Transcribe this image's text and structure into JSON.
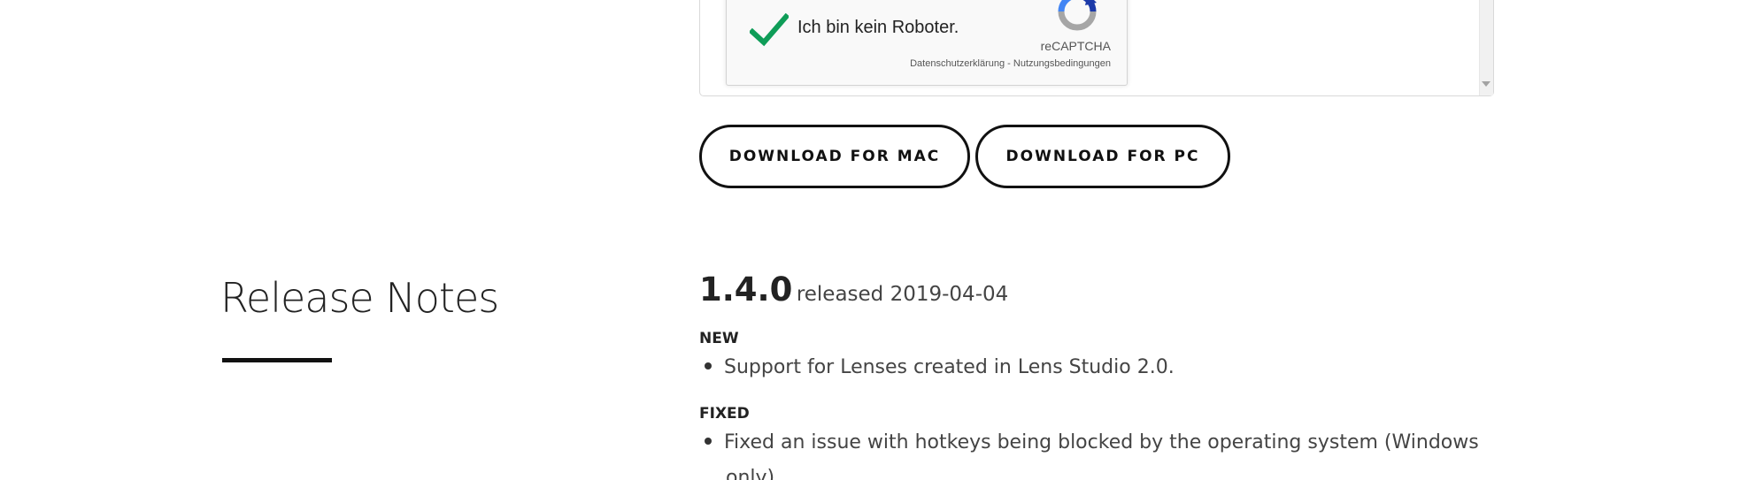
{
  "recaptcha": {
    "label": "Ich bin kein Roboter.",
    "brand": "reCAPTCHA",
    "privacy_link": "Datenschutzerklärung",
    "separator": " - ",
    "terms_link": "Nutzungsbedingungen",
    "checked": true,
    "check_color": "#0f9d58"
  },
  "downloads": {
    "mac_label": "DOWNLOAD FOR MAC",
    "pc_label": "DOWNLOAD FOR PC"
  },
  "release_notes": {
    "title": "Release Notes",
    "version": "1.4.0",
    "released_text": "released 2019-04-04",
    "sections": [
      {
        "heading": "NEW",
        "items": [
          "Support for Lenses created in Lens Studio 2.0."
        ]
      },
      {
        "heading": "FIXED",
        "items": [
          "Fixed an issue with hotkeys being blocked by the operating system (Windows",
          "only)."
        ]
      }
    ]
  }
}
